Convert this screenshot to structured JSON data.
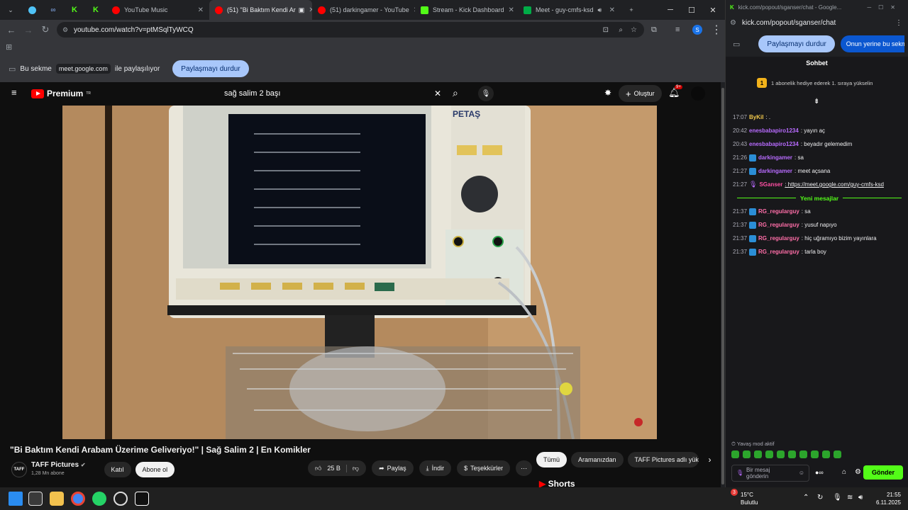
{
  "browser": {
    "tabs": [
      {
        "label": "YouTube Music"
      },
      {
        "label": "(51) \"Bi Baktım Kendi Ar"
      },
      {
        "label": "(51) darkingamer - YouTube"
      },
      {
        "label": "Stream - Kick Dashboard"
      },
      {
        "label": "Meet - guy-cmfs-ksd"
      }
    ],
    "url": "youtube.com/watch?v=ptMSqlTyWCQ",
    "share_text_1": "Bu sekme",
    "share_domain": "meet.google.com",
    "share_text_2": "ile paylaşılıyor",
    "stop_share": "Paylaşmayı durdur",
    "profile_initial": "S"
  },
  "youtube": {
    "logo_text": "Premium",
    "logo_sup": "TR",
    "search_value": "sağ salim 2 başı",
    "create_label": "Oluştur",
    "notif_count": "9+",
    "video_title": "\"Bi Baktım Kendi Arabam Üzerime Geliveriyo!\" | Sağ Salim 2 | En Komikler",
    "channel_name": "TAFF Pictures",
    "channel_avatar_text": "TAFF",
    "subscribers": "1,28 Mn abone",
    "join": "Katıl",
    "subscribe": "Abone ol",
    "likes": "25 B",
    "share": "Paylaş",
    "download": "İndir",
    "thanks": "Teşekkürler",
    "filters": [
      "Tümü",
      "Aramanızdan",
      "TAFF Pictures adlı yükle"
    ],
    "shorts": "Shorts",
    "monitor_brand": "PETAŞ"
  },
  "kick": {
    "window_title": "kick.com/popout/sganser/chat - Google...",
    "address": "kick.com/popout/sganser/chat",
    "stop_share": "Paylaşmayı durdur",
    "share_instead": "Onun yerine bu sekmeyi p",
    "chat_header": "Sohbet",
    "gift_count": "1",
    "gift_text": "1 abonelik hediye ederek 1. sıraya yükselin",
    "messages": [
      {
        "time": "17:07",
        "user": "ByKil",
        "text": ": .",
        "color": "#f2c94c"
      },
      {
        "time": "20:42",
        "user": "enesbabapiro1234",
        "text": ": yayın aç",
        "color": "#b86bff"
      },
      {
        "time": "20:43",
        "user": "enesbabapiro1234",
        "text": ": beyadır gelemedim",
        "color": "#b86bff"
      },
      {
        "time": "21:26",
        "user": "darkingamer",
        "text": ": sa",
        "color": "#b86bff"
      },
      {
        "time": "21:27",
        "user": "darkingamer",
        "text": ": meet açsana",
        "color": "#b86bff"
      },
      {
        "time": "21:27",
        "user": "SGanser",
        "text": ": https://meet.google.com/guy-cmfs-ksd",
        "color": "#ff4fa3"
      }
    ],
    "new_messages": "Yeni mesajlar",
    "messages2": [
      {
        "time": "21:37",
        "user": "RG_regularguy",
        "text": ": sa",
        "color": "#ff6ea8"
      },
      {
        "time": "21:37",
        "user": "RG_regularguy",
        "text": ": yusuf napıyo",
        "color": "#ff6ea8"
      },
      {
        "time": "21:37",
        "user": "RG_regularguy",
        "text": ": hiç uğramıyo bizim yayınlara",
        "color": "#ff6ea8"
      },
      {
        "time": "21:37",
        "user": "RG_regularguy",
        "text": ": tarla boy",
        "color": "#ff6ea8"
      }
    ],
    "slow_mode": "Yavaş mod aktif",
    "input_placeholder": "Bir mesaj gönderin",
    "send": "Gönder"
  },
  "taskbar": {
    "temp": "15°C",
    "weather": "Bulutlu",
    "weather_badge": "3",
    "time": "21:55",
    "date": "6.11.2025"
  }
}
